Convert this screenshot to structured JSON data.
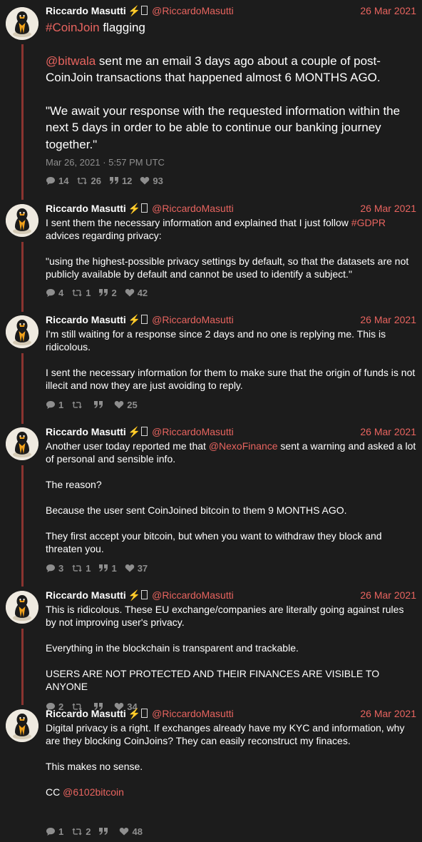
{
  "colors": {
    "background": "#1c1c1c",
    "accent": "#e8645f",
    "muted": "#8e8e8e",
    "thread_line": "#8a3430"
  },
  "author": {
    "name": "Riccardo Masutti",
    "emoji": "⚡",
    "handle": "@RiccardoMasutti"
  },
  "tweets": [
    {
      "date": "26 Mar 2021",
      "segments": [
        [
          {
            "t": "#CoinJoin",
            "link": true
          },
          {
            "t": " flagging"
          }
        ],
        [
          {
            "t": "@bitwala",
            "link": true
          },
          {
            "t": " sent me an email 3 days ago about a couple of post-CoinJoin transactions that happened almost 6 MONTHS AGO."
          }
        ],
        [
          {
            "t": "\"We await your response with the requested information within the next 5 days in order to be able to continue our banking journey together.\""
          }
        ]
      ],
      "timestamp": "Mar 26, 2021 · 5:57 PM UTC",
      "replies": "14",
      "retweets": "26",
      "quotes": "12",
      "likes": "93"
    },
    {
      "date": "26 Mar 2021",
      "segments": [
        [
          {
            "t": "I sent them the necessary information and explained that I just follow "
          },
          {
            "t": "#GDPR",
            "link": true
          },
          {
            "t": " advices regarding privacy:"
          }
        ],
        [
          {
            "t": "\"using the highest-possible privacy settings by default, so that the datasets are not publicly available by default and cannot be used to identify a subject.\""
          }
        ]
      ],
      "replies": "4",
      "retweets": "1",
      "quotes": "2",
      "likes": "42"
    },
    {
      "date": "26 Mar 2021",
      "segments": [
        [
          {
            "t": "I'm still waiting for a response since 2 days and no one is replying me. This is ridicolous."
          }
        ],
        [
          {
            "t": "I sent the necessary information for them to make sure that the origin of funds is not illecit and now they are just avoiding to reply."
          }
        ]
      ],
      "replies": "1",
      "retweets": "",
      "quotes": "",
      "likes": "25"
    },
    {
      "date": "26 Mar 2021",
      "segments": [
        [
          {
            "t": "Another user today reported me that "
          },
          {
            "t": "@NexoFinance",
            "link": true
          },
          {
            "t": " sent a warning and asked a lot of personal and sensible info."
          }
        ],
        [
          {
            "t": "The reason?"
          }
        ],
        [
          {
            "t": "Because the user sent CoinJoined bitcoin to them 9 MONTHS AGO."
          }
        ],
        [
          {
            "t": "They first accept your bitcoin, but when you want to withdraw they block and threaten you."
          }
        ]
      ],
      "replies": "3",
      "retweets": "1",
      "quotes": "1",
      "likes": "37"
    },
    {
      "date": "26 Mar 2021",
      "segments": [
        [
          {
            "t": "This is ridicolous. These EU exchange/companies are literally going against rules by not improving user's privacy."
          }
        ],
        [
          {
            "t": "Everything in the blockchain is transparent and trackable."
          }
        ],
        [
          {
            "t": "USERS ARE NOT PROTECTED AND THEIR FINANCES ARE VISIBLE TO ANYONE"
          }
        ]
      ],
      "replies": "2",
      "retweets": "",
      "quotes": "",
      "likes": "34"
    },
    {
      "date": "26 Mar 2021",
      "segments": [
        [
          {
            "t": "Digital privacy is a right. If exchanges already have my KYC and information, why are they blocking CoinJoins? They can easily reconstruct my finaces."
          }
        ],
        [
          {
            "t": "This makes no sense."
          }
        ],
        [
          {
            "t": "CC "
          },
          {
            "t": "@6102bitcoin",
            "link": true
          }
        ]
      ],
      "replies": "1",
      "retweets": "2",
      "quotes": "",
      "likes": "48"
    }
  ]
}
